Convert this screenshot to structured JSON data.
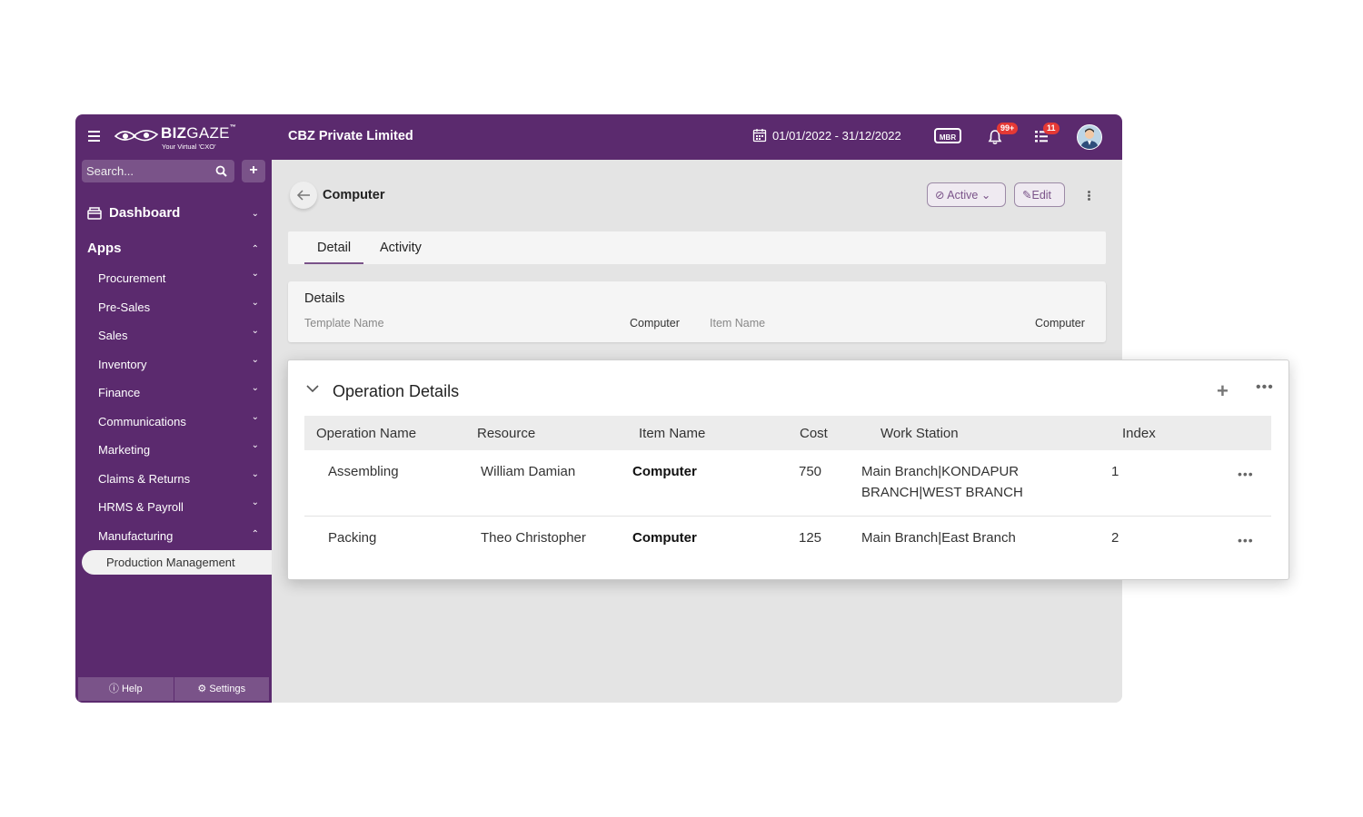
{
  "header": {
    "logo_brand_bold": "BIZ",
    "logo_brand_light": "GAZE",
    "logo_tm": "™",
    "logo_tagline": "Your Virtual 'CXO'",
    "company": "CBZ Private Limited",
    "date_range": "01/01/2022 - 31/12/2022",
    "mbr_label": "MBR",
    "notifications_badge": "99+",
    "tasks_badge": "11"
  },
  "sidebar": {
    "search_placeholder": "Search...",
    "dashboard": "Dashboard",
    "apps": "Apps",
    "items": [
      {
        "label": "Procurement"
      },
      {
        "label": "Pre-Sales"
      },
      {
        "label": "Sales"
      },
      {
        "label": "Inventory"
      },
      {
        "label": "Finance"
      },
      {
        "label": "Communications"
      },
      {
        "label": "Marketing"
      },
      {
        "label": "Claims & Returns"
      },
      {
        "label": "HRMS & Payroll"
      },
      {
        "label": "Manufacturing"
      }
    ],
    "active_item": "Production Management",
    "help": "Help",
    "settings": "Settings"
  },
  "record": {
    "title": "Computer",
    "status": "Active",
    "edit": "Edit"
  },
  "tabs": [
    {
      "label": "Detail"
    },
    {
      "label": "Activity"
    }
  ],
  "details": {
    "heading": "Details",
    "template_name_label": "Template Name",
    "template_name_value": "Computer",
    "item_name_label": "Item Name",
    "item_name_value": "Computer"
  },
  "operations": {
    "title": "Operation Details",
    "columns": [
      "Operation Name",
      "Resource",
      "Item Name",
      "Cost",
      "Work Station",
      "Index"
    ],
    "rows": [
      {
        "name": "Assembling",
        "resource": "William Damian",
        "item": "Computer",
        "cost": "750",
        "ws_line1": "Main Branch|KONDAPUR",
        "ws_line2": "BRANCH|WEST BRANCH",
        "index": "1"
      },
      {
        "name": "Packing",
        "resource": "Theo Christopher",
        "item": "Computer",
        "cost": "125",
        "ws_line1": "Main Branch|East Branch",
        "ws_line2": "",
        "index": "2"
      }
    ]
  },
  "colors": {
    "brand_purple": "#5b2a6e",
    "sidebar_control": "#7a5389",
    "badge_red": "#e53935"
  }
}
